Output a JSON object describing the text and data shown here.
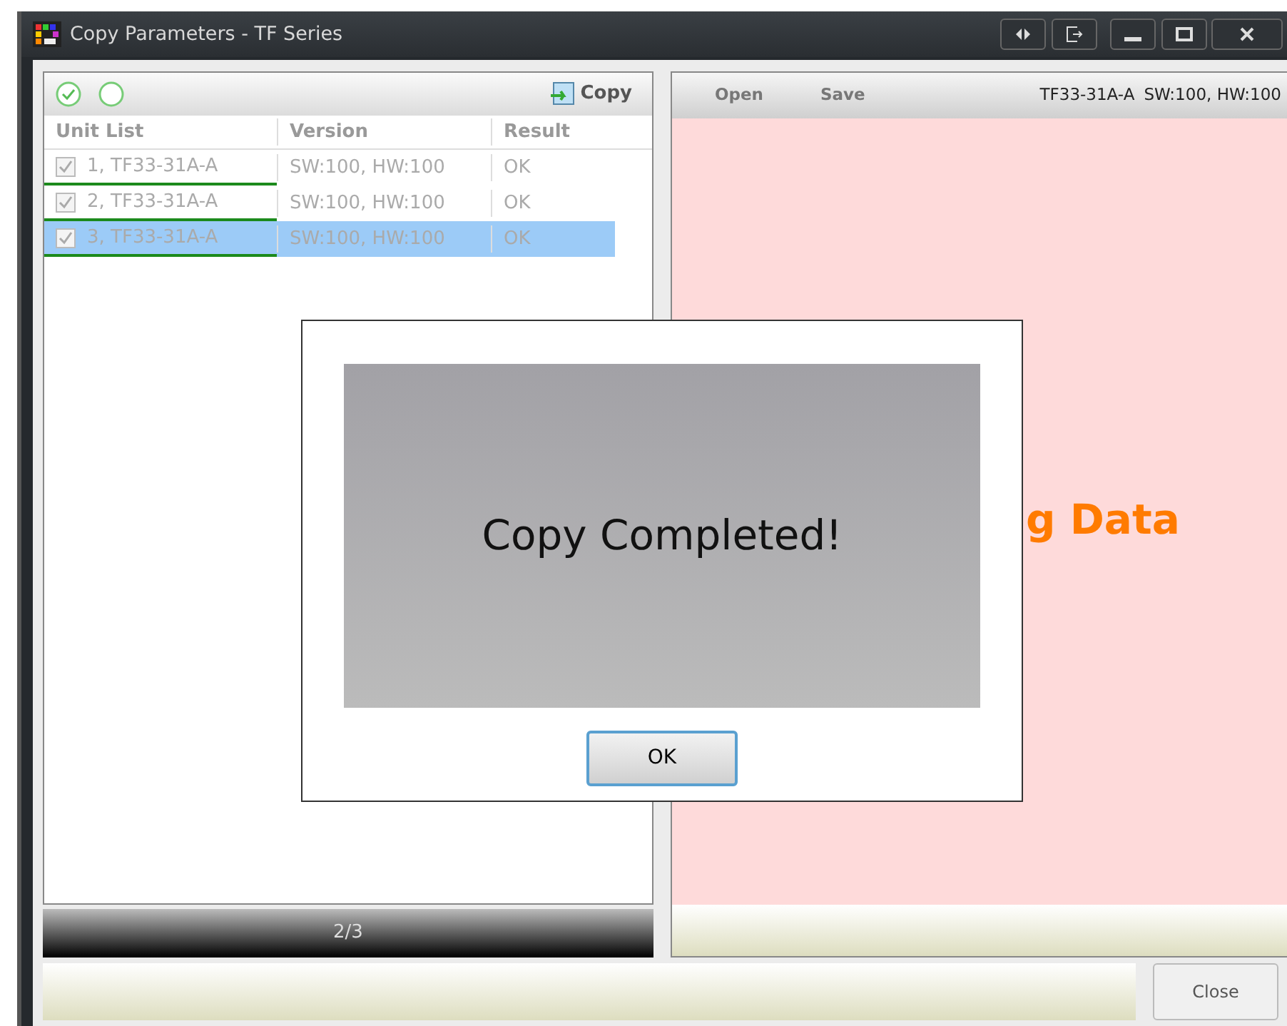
{
  "window": {
    "title": "Copy Parameters - TF Series"
  },
  "left_panel": {
    "copy_button": "Copy",
    "table": {
      "columns": [
        "Unit List",
        "Version",
        "Result"
      ],
      "rows": [
        {
          "unit": "1, TF33-31A-A",
          "checked": true,
          "selected": false,
          "version": "SW:100, HW:100",
          "result": "OK"
        },
        {
          "unit": "2, TF33-31A-A",
          "checked": true,
          "selected": false,
          "version": "SW:100, HW:100",
          "result": "OK"
        },
        {
          "unit": "3, TF33-31A-A",
          "checked": true,
          "selected": true,
          "version": "SW:100, HW:100",
          "result": "OK"
        }
      ]
    },
    "status": "2/3"
  },
  "right_panel": {
    "buttons": [
      "Open",
      "Save"
    ],
    "unit": "TF33-31A-A",
    "version": "SW:100, HW:100",
    "message": "g Data"
  },
  "dialog": {
    "message": "Copy Completed!",
    "button": "OK"
  },
  "footer": {
    "close_button": "Close"
  }
}
